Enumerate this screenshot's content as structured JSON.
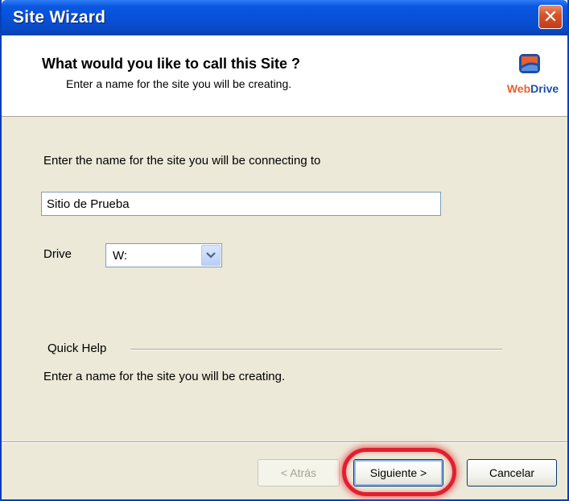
{
  "window": {
    "title": "Site Wizard",
    "close_glyph": "✕"
  },
  "header": {
    "title": "What would you like to call this Site ?",
    "subtitle": "Enter a name for the site you will be creating.",
    "logo": {
      "web": "Web",
      "drive": "Drive",
      "icon": "webdrive-logo-icon"
    }
  },
  "form": {
    "prompt": "Enter the name for the site you will be connecting to",
    "site_name_value": "Sitio de Prueba",
    "drive_label": "Drive",
    "drive_value": "W:"
  },
  "quick_help": {
    "label": "Quick Help",
    "text": "Enter a name for the site you will be creating."
  },
  "buttons": {
    "back": "< Atrás",
    "next": "Siguiente >",
    "cancel": "Cancelar"
  },
  "colors": {
    "title_bar": "#0850d8",
    "dialog_bg": "#ece9d8",
    "highlight": "#e0202f",
    "logo_orange": "#e8602c",
    "logo_blue": "#1c4fa8"
  }
}
